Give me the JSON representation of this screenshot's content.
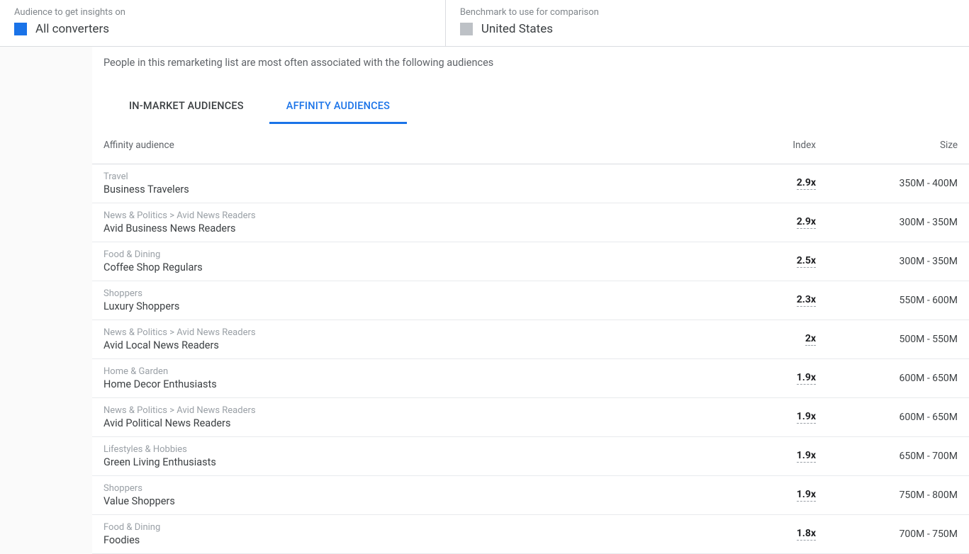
{
  "header": {
    "audience_label": "Audience to get insights on",
    "audience_value": "All converters",
    "benchmark_label": "Benchmark to use for comparison",
    "benchmark_value": "United States"
  },
  "intro": "People in this remarketing list are most often associated with the following audiences",
  "tabs": {
    "in_market": "IN-MARKET AUDIENCES",
    "affinity": "AFFINITY AUDIENCES"
  },
  "columns": {
    "audience": "Affinity audience",
    "index": "Index",
    "size": "Size"
  },
  "rows": [
    {
      "category": "Travel",
      "name": "Business Travelers",
      "index": "2.9x",
      "size": "350M - 400M"
    },
    {
      "category": "News & Politics > Avid News Readers",
      "name": "Avid Business News Readers",
      "index": "2.9x",
      "size": "300M - 350M"
    },
    {
      "category": "Food & Dining",
      "name": "Coffee Shop Regulars",
      "index": "2.5x",
      "size": "300M - 350M"
    },
    {
      "category": "Shoppers",
      "name": "Luxury Shoppers",
      "index": "2.3x",
      "size": "550M - 600M"
    },
    {
      "category": "News & Politics > Avid News Readers",
      "name": "Avid Local News Readers",
      "index": "2x",
      "size": "500M - 550M"
    },
    {
      "category": "Home & Garden",
      "name": "Home Decor Enthusiasts",
      "index": "1.9x",
      "size": "600M - 650M"
    },
    {
      "category": "News & Politics > Avid News Readers",
      "name": "Avid Political News Readers",
      "index": "1.9x",
      "size": "600M - 650M"
    },
    {
      "category": "Lifestyles & Hobbies",
      "name": "Green Living Enthusiasts",
      "index": "1.9x",
      "size": "650M - 700M"
    },
    {
      "category": "Shoppers",
      "name": "Value Shoppers",
      "index": "1.9x",
      "size": "750M - 800M"
    },
    {
      "category": "Food & Dining",
      "name": "Foodies",
      "index": "1.8x",
      "size": "700M - 750M"
    }
  ]
}
